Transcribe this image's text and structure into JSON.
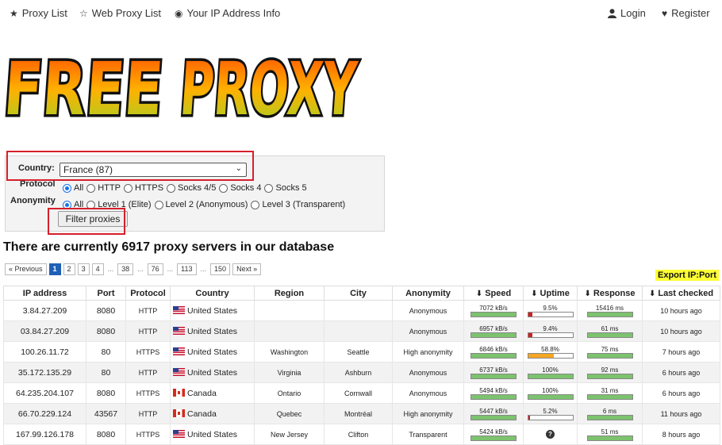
{
  "nav": {
    "proxy_list": "Proxy List",
    "web_proxy_list": "Web Proxy List",
    "ip_info": "Your IP Address Info",
    "login": "Login",
    "register": "Register"
  },
  "logo": {
    "text": "FREE PROXY"
  },
  "filter": {
    "country_label": "Country:",
    "country_value": "France (87)",
    "protocol_label": "Protocol",
    "protocol_options": [
      "All",
      "HTTP",
      "HTTPS",
      "Socks 4/5",
      "Socks 4",
      "Socks 5"
    ],
    "anonymity_label": "Anonymity",
    "anonymity_options": [
      "All",
      "Level 1 (Elite)",
      "Level 2 (Anonymous)",
      "Level 3 (Transparent)"
    ],
    "button_label": "Filter proxies"
  },
  "heading": "There are currently 6917 proxy servers in our database",
  "pagination": {
    "prev": "« Previous",
    "pages": [
      "1",
      "2",
      "3",
      "4",
      "...",
      "38",
      "...",
      "76",
      "...",
      "113",
      "...",
      "150"
    ],
    "next": "Next »",
    "current": "1"
  },
  "export_label": "Export IP:Port",
  "table": {
    "headers": [
      "IP address",
      "Port",
      "Protocol",
      "Country",
      "Region",
      "City",
      "Anonymity",
      "Speed",
      "Uptime",
      "Response",
      "Last checked"
    ],
    "rows": [
      {
        "ip": "3.84.27.209",
        "port": "8080",
        "protocol": "HTTP",
        "flag": "us",
        "country": "United States",
        "region": "",
        "city": "",
        "anonymity": "Anonymous",
        "speed": "7072 kB/s",
        "speed_level": 1.0,
        "uptime": "9.5%",
        "uptime_level": 0.095,
        "uptime_color": "#cc1f1f",
        "response": "15416 ms",
        "response_level": 1.0,
        "last_checked": "10 hours ago"
      },
      {
        "ip": "03.84.27.209",
        "port": "8080",
        "protocol": "HTTP",
        "flag": "us",
        "country": "United States",
        "region": "",
        "city": "",
        "anonymity": "Anonymous",
        "speed": "6957 kB/s",
        "speed_level": 1.0,
        "uptime": "9.4%",
        "uptime_level": 0.094,
        "uptime_color": "#cc1f1f",
        "response": "61 ms",
        "response_level": 1.0,
        "last_checked": "10 hours ago"
      },
      {
        "ip": "100.26.11.72",
        "port": "80",
        "protocol": "HTTPS",
        "flag": "us",
        "country": "United States",
        "region": "Washington",
        "city": "Seattle",
        "anonymity": "High anonymity",
        "speed": "6846 kB/s",
        "speed_level": 1.0,
        "uptime": "58.8%",
        "uptime_level": 0.588,
        "uptime_color": "#f5a623",
        "response": "75 ms",
        "response_level": 1.0,
        "last_checked": "7 hours ago"
      },
      {
        "ip": "35.172.135.29",
        "port": "80",
        "protocol": "HTTP",
        "flag": "us",
        "country": "United States",
        "region": "Virginia",
        "city": "Ashburn",
        "anonymity": "Anonymous",
        "speed": "6737 kB/s",
        "speed_level": 1.0,
        "uptime": "100%",
        "uptime_level": 1.0,
        "uptime_color": "#7cc36e",
        "response": "92 ms",
        "response_level": 1.0,
        "last_checked": "6 hours ago"
      },
      {
        "ip": "64.235.204.107",
        "port": "8080",
        "protocol": "HTTPS",
        "flag": "ca",
        "country": "Canada",
        "region": "Ontario",
        "city": "Cornwall",
        "anonymity": "Anonymous",
        "speed": "5494 kB/s",
        "speed_level": 1.0,
        "uptime": "100%",
        "uptime_level": 1.0,
        "uptime_color": "#7cc36e",
        "response": "31 ms",
        "response_level": 1.0,
        "last_checked": "6 hours ago"
      },
      {
        "ip": "66.70.229.124",
        "port": "43567",
        "protocol": "HTTP",
        "flag": "ca",
        "country": "Canada",
        "region": "Quebec",
        "city": "Montréal",
        "anonymity": "High anonymity",
        "speed": "5447 kB/s",
        "speed_level": 1.0,
        "uptime": "5.2%",
        "uptime_level": 0.052,
        "uptime_color": "#cc1f1f",
        "response": "6 ms",
        "response_level": 1.0,
        "last_checked": "11 hours ago"
      },
      {
        "ip": "167.99.126.178",
        "port": "8080",
        "protocol": "HTTPS",
        "flag": "us",
        "country": "United States",
        "region": "New Jersey",
        "city": "Clifton",
        "anonymity": "Transparent",
        "speed": "5424 kB/s",
        "speed_level": 1.0,
        "uptime": "?",
        "uptime_level": null,
        "uptime_color": "#333333",
        "response": "51 ms",
        "response_level": 1.0,
        "last_checked": "8 hours ago"
      }
    ]
  },
  "colors": {
    "meter_green": "#7cc36e",
    "active_page": "#1f5fb6",
    "highlight": "#d61f2b",
    "export_bg": "#ffff33"
  },
  "icons": {
    "proxy_list": "star-icon",
    "web_proxy_list": "star-icon",
    "ip_info": "eye-icon",
    "login": "user-icon",
    "register": "heart-icon",
    "sort": "arrow-down-icon",
    "uptime_unknown": "question-icon"
  }
}
